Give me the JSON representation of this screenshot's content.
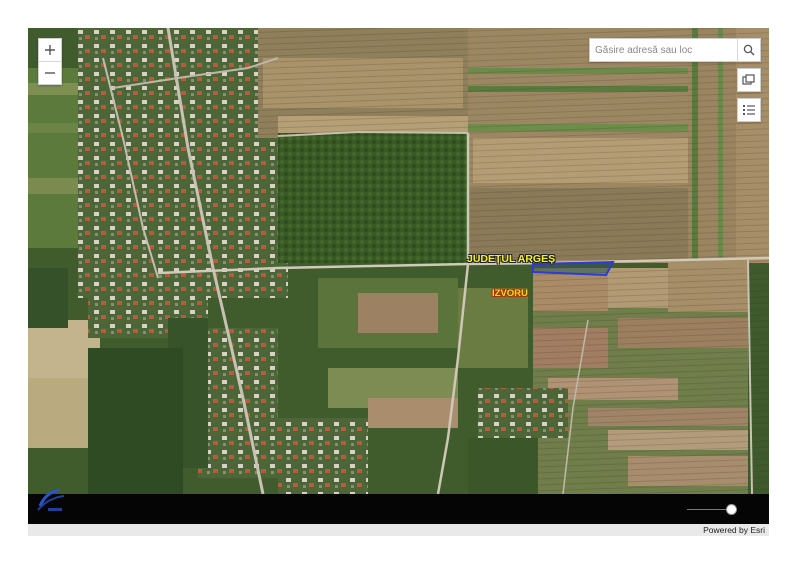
{
  "map": {
    "labels": {
      "county": "JUDEȚUL ARGEȘ",
      "village": "IZVORU"
    },
    "search": {
      "placeholder": "Găsire adresă sau loc",
      "value": ""
    },
    "controls": {
      "zoom_in_icon": "plus-icon",
      "zoom_out_icon": "minus-icon",
      "search_icon": "magnifier-icon",
      "basemap_icon": "basemap-gallery-icon",
      "legend_icon": "legend-list-icon"
    },
    "time_slider_level": 0.88,
    "colors": {
      "parcel_outline": "#2b3bd4",
      "county_label": "#f3f22a",
      "village_label": "#ffd21f",
      "bottom_bar": "#050505"
    }
  },
  "footer": {
    "attribution": "Powered by Esri"
  }
}
